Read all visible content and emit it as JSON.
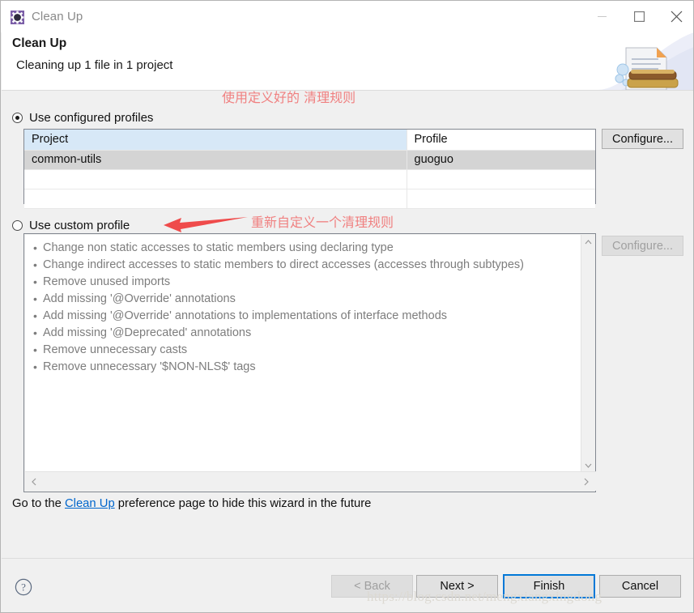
{
  "window": {
    "title": "Clean Up",
    "icon": "gear-icon",
    "controls": {
      "minimize": "minimize-icon",
      "maximize": "maximize-icon",
      "close": "close-icon"
    }
  },
  "header": {
    "title": "Clean Up",
    "subtitle": "Cleaning up 1 file in 1 project",
    "banner_icon": "document-brush-icon"
  },
  "options": {
    "configured": {
      "label": "Use configured profiles",
      "selected": true
    },
    "custom": {
      "label": "Use custom profile",
      "selected": false
    }
  },
  "annotations": [
    {
      "text": "使用定义好的 清理规则",
      "color": "#f08080",
      "arrow": "arrow-left-angled"
    },
    {
      "text": "重新自定义一个清理规则",
      "color": "#f08080",
      "arrow": "arrow-left-straight"
    }
  ],
  "project_table": {
    "columns": [
      "Project",
      "Profile"
    ],
    "rows": [
      {
        "project": "common-utils",
        "profile": "guoguo",
        "selected": true
      },
      {
        "project": "",
        "profile": "",
        "selected": false
      },
      {
        "project": "",
        "profile": "",
        "selected": false
      }
    ],
    "header_highlight_color": "#d7e8f7",
    "selected_row_color": "#d4d4d4"
  },
  "buttons": {
    "configure_top": {
      "label": "Configure...",
      "enabled": true
    },
    "configure_bottom": {
      "label": "Configure...",
      "enabled": false
    },
    "back": {
      "label": "< Back",
      "enabled": false
    },
    "next": {
      "label": "Next >",
      "enabled": true
    },
    "finish": {
      "label": "Finish",
      "enabled": true,
      "default": true,
      "focus_color": "#0078d7"
    },
    "cancel": {
      "label": "Cancel",
      "enabled": true
    },
    "help": "help-icon"
  },
  "custom_profile_rules": [
    "Change non static accesses to static members using declaring type",
    "Change indirect accesses to static members to direct accesses (accesses through subtypes)",
    "Remove unused imports",
    "Add missing '@Override' annotations",
    "Add missing '@Override' annotations to implementations of interface methods",
    "Add missing '@Deprecated' annotations",
    "Remove unnecessary casts",
    "Remove unnecessary '$NON-NLS$' tags"
  ],
  "footer": {
    "prefix": "Go to the ",
    "link": "Clean Up",
    "suffix": " preference page to hide this wizard in the future"
  },
  "watermark": "https://blog.csdn.net/mengxiangxingdong"
}
